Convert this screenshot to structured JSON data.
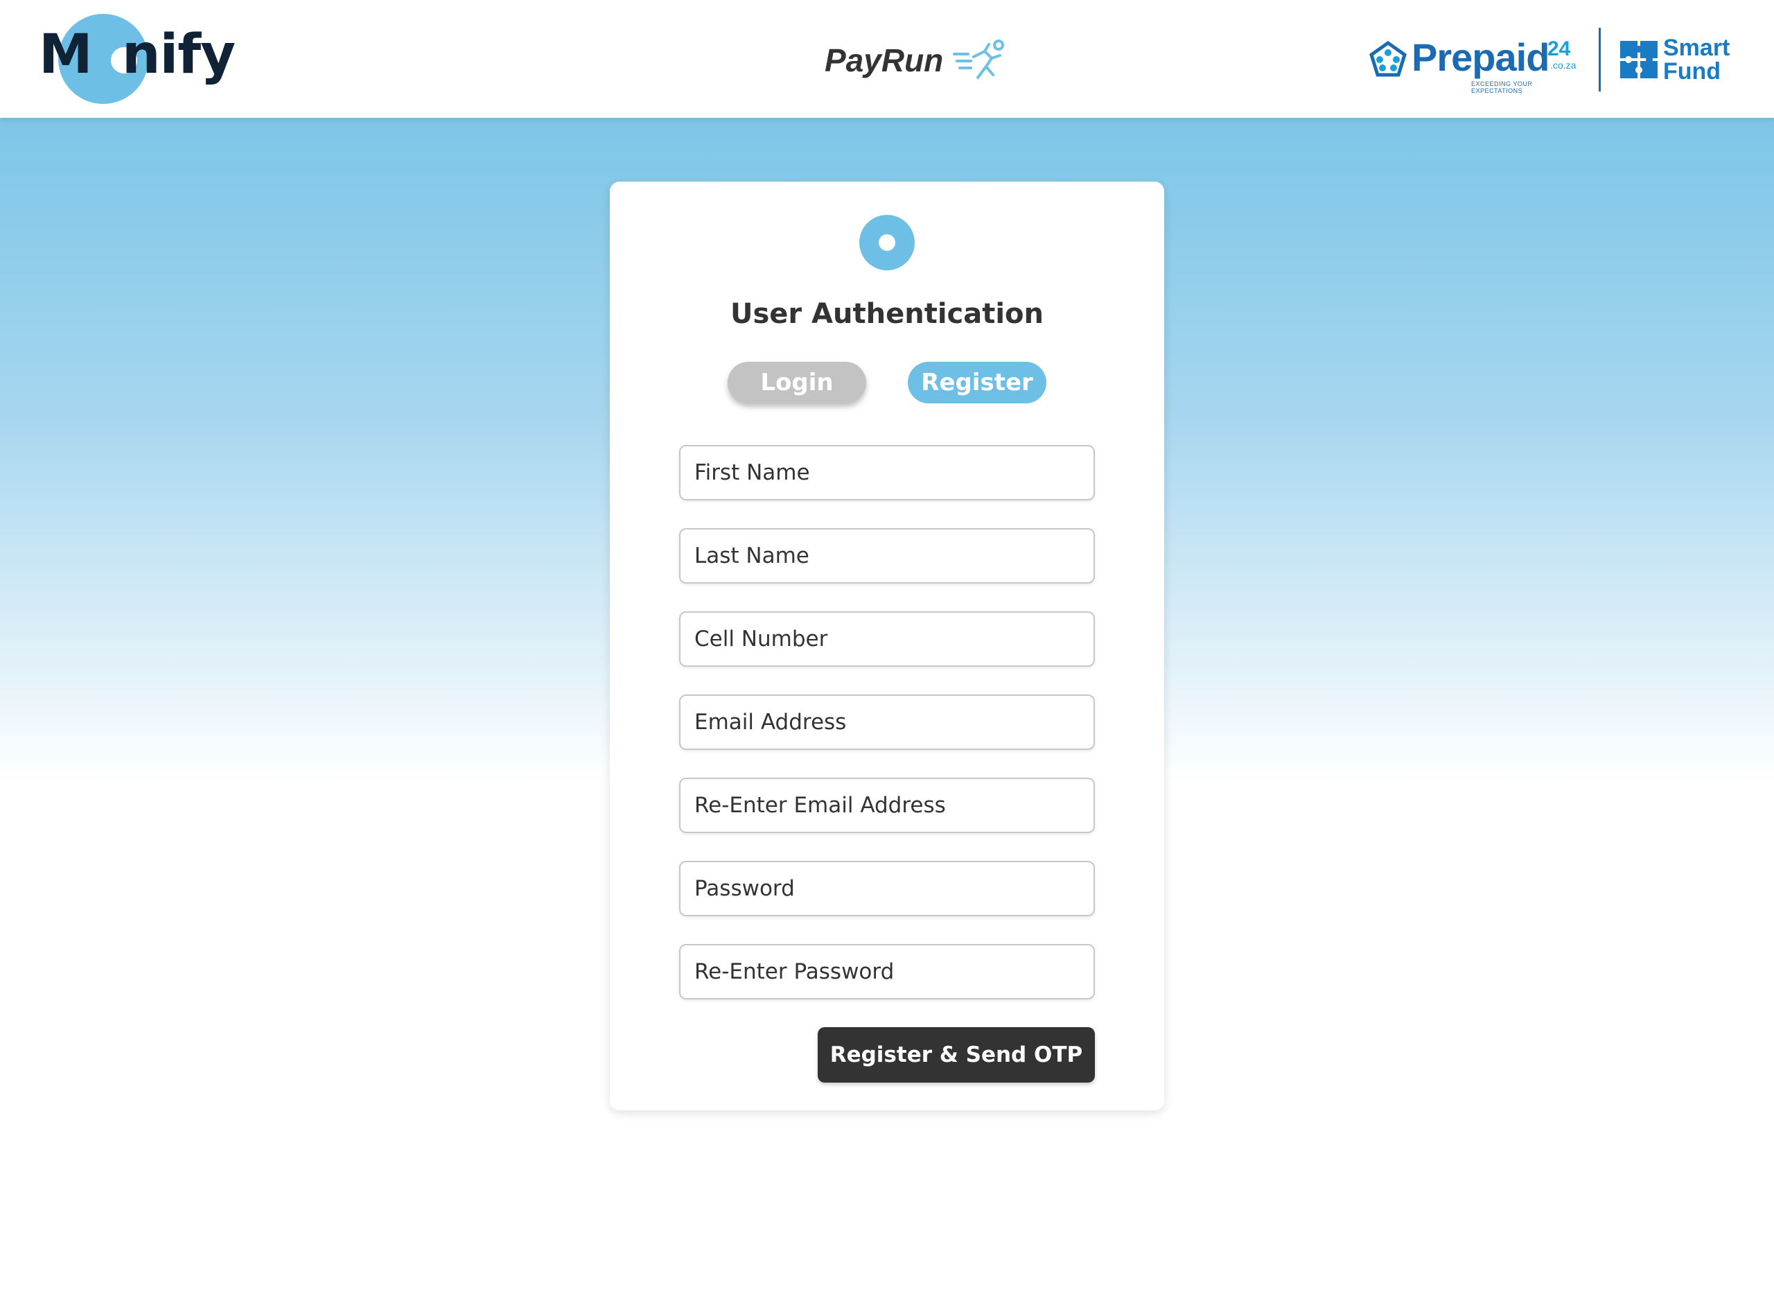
{
  "header": {
    "brand": {
      "m": "M",
      "rest": "nify"
    },
    "app_name": "PayRun",
    "partners": {
      "prepaid": {
        "name": "Prepaid",
        "number": "24",
        "domain": ".co.za",
        "tagline": "EXCEEDING YOUR EXPECTATIONS"
      },
      "smartfund": {
        "line1": "Smart",
        "line2": "Fund"
      }
    }
  },
  "auth": {
    "title": "User Authentication",
    "tabs": {
      "login": "Login",
      "register": "Register",
      "active": "register"
    },
    "fields": {
      "first_name": "First Name",
      "last_name": "Last Name",
      "cell_number": "Cell Number",
      "email": "Email Address",
      "email_confirm": "Re-Enter Email Address",
      "password": "Password",
      "password_confirm": "Re-Enter Password"
    },
    "submit_label": "Register & Send OTP"
  },
  "colors": {
    "accent": "#6dbfe5",
    "brand_dark": "#0f2236",
    "button_dark": "#333333",
    "inactive_tab": "#c3c3c3",
    "partner_blue": "#1a6bb3"
  },
  "icons": {
    "app": "runner-icon",
    "prepaid": "pentagon-people-icon",
    "smartfund": "puzzle-icon"
  }
}
